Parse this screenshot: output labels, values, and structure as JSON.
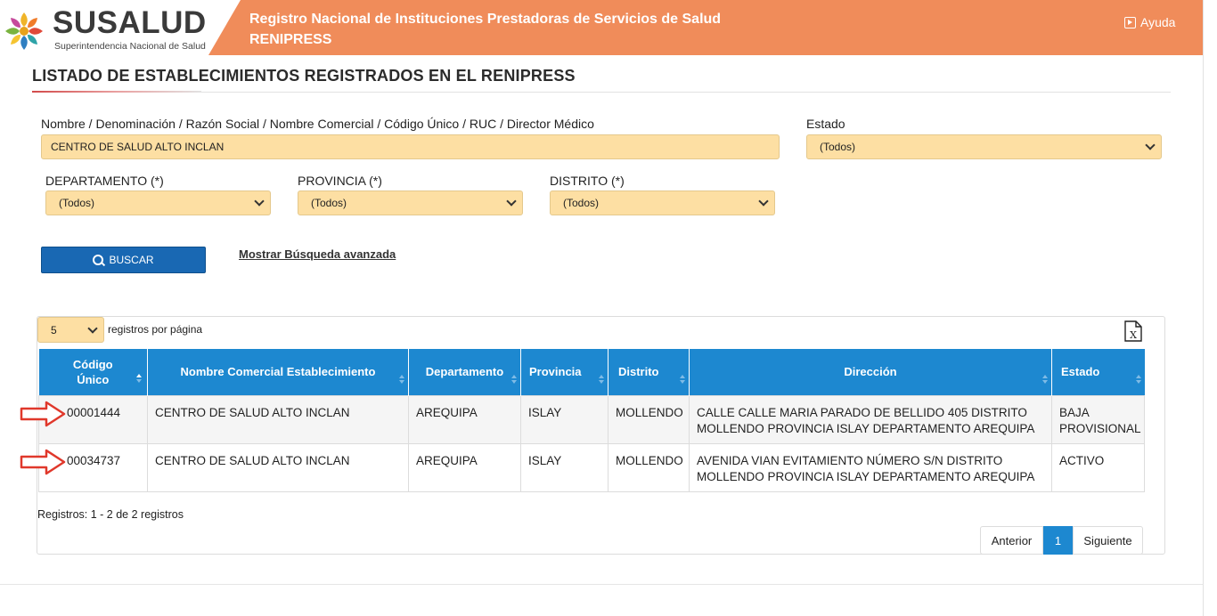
{
  "header": {
    "brand": "SUSALUD",
    "brand_sub": "Superintendencia Nacional de Salud",
    "title_line1": "Registro Nacional de Instituciones Prestadoras de Servicios de Salud",
    "title_line2": "RENIPRESS",
    "help_label": "Ayuda",
    "band_color": "#f08c5a"
  },
  "page": {
    "title": "LISTADO DE ESTABLECIMIENTOS REGISTRADOS EN EL RENIPRESS"
  },
  "form": {
    "name_label": "Nombre / Denominación / Razón Social / Nombre Comercial / Código Único / RUC / Director Médico",
    "name_value": "CENTRO DE SALUD ALTO INCLAN",
    "estado_label": "Estado",
    "estado_value": "(Todos)",
    "departamento_label": "DEPARTAMENTO (*)",
    "departamento_value": "(Todos)",
    "provincia_label": "PROVINCIA (*)",
    "provincia_value": "(Todos)",
    "distrito_label": "DISTRITO (*)",
    "distrito_value": "(Todos)",
    "search_label": "BUSCAR",
    "advanced_link": "Mostrar Búsqueda avanzada",
    "field_color": "#fddfa3",
    "button_color": "#1968b3"
  },
  "results": {
    "per_page_value": "5",
    "per_page_label": "registros por página",
    "columns": [
      {
        "line1": "Código",
        "line2": "Único"
      },
      {
        "line1": "Nombre Comercial Establecimiento",
        "line2": ""
      },
      {
        "line1": "Departamento",
        "line2": ""
      },
      {
        "line1": "Provincia",
        "line2": ""
      },
      {
        "line1": "Distrito",
        "line2": ""
      },
      {
        "line1": "Dirección",
        "line2": ""
      },
      {
        "line1": "Estado",
        "line2": ""
      }
    ],
    "rows": [
      {
        "codigo": "00001444",
        "nombre": "CENTRO DE SALUD ALTO INCLAN",
        "departamento": "AREQUIPA",
        "provincia": "ISLAY",
        "distrito": "MOLLENDO",
        "direccion": "CALLE CALLE MARIA PARADO DE BELLIDO 405 DISTRITO MOLLENDO PROVINCIA ISLAY DEPARTAMENTO AREQUIPA",
        "estado": "BAJA PROVISIONAL"
      },
      {
        "codigo": "00034737",
        "nombre": "CENTRO DE SALUD ALTO INCLAN",
        "departamento": "AREQUIPA",
        "provincia": "ISLAY",
        "distrito": "MOLLENDO",
        "direccion": "AVENIDA VIAN EVITAMIENTO NÚMERO S/N DISTRITO MOLLENDO PROVINCIA ISLAY DEPARTAMENTO AREQUIPA",
        "estado": "ACTIVO"
      }
    ],
    "records_info": "Registros: 1 - 2 de 2 registros",
    "pager": {
      "prev": "Anterior",
      "current": "1",
      "next": "Siguiente"
    },
    "header_color": "#1d88d0",
    "annotation_arrow_color": "#e0382b"
  },
  "icons": {
    "logo": "susalud-logo-icon",
    "help": "play-box-icon",
    "search": "search-icon",
    "export": "excel-export-icon",
    "sort": "sort-icon",
    "annotation": "red-arrow-icon"
  }
}
